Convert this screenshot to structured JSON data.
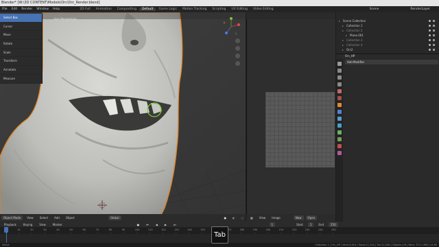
{
  "window": {
    "title": "Blender* [W:\\3D CONTENT\\Models\\Orc\\Orc_Render.blend]"
  },
  "menu": {
    "items": [
      "File",
      "Edit",
      "Render",
      "Window",
      "Help"
    ],
    "workspaces": [
      "2D Full",
      "Animation",
      "Compositing",
      "Default",
      "Game Logic",
      "Motion Tracking",
      "Scripting",
      "UV Editing",
      "Video Editing"
    ],
    "active_workspace": "Default",
    "scene_label": "Scene",
    "viewlayer_label": "RenderLayer"
  },
  "viewport": {
    "overlay_text": "User Perspective",
    "tools": [
      "Select Box",
      "Cursor",
      "Move",
      "Rotate",
      "Scale",
      "Transform",
      "Annotate",
      "Measure"
    ],
    "footer": {
      "mode": "Object Mode",
      "view": "View",
      "select": "Select",
      "add": "Add",
      "object": "Object",
      "orientation": "Global"
    }
  },
  "image_editor": {
    "view": "View",
    "image": "Image",
    "new": "New",
    "open": "Open"
  },
  "outliner": {
    "rows": [
      {
        "label": "Scene Collection",
        "dim": false,
        "indent": 0
      },
      {
        "label": "Collection 1",
        "dim": false,
        "indent": 1
      },
      {
        "label": "Collection 2",
        "dim": true,
        "indent": 1
      },
      {
        "label": "Plane.001",
        "dim": false,
        "indent": 2
      },
      {
        "label": "Collection 3",
        "dim": true,
        "indent": 1
      },
      {
        "label": "Collection 4",
        "dim": true,
        "indent": 1
      },
      {
        "label": "Orc2",
        "dim": false,
        "indent": 1
      }
    ]
  },
  "properties": {
    "object_name": "Orc_HP",
    "add_modifier": "Add Modifier"
  },
  "timeline": {
    "menus": [
      "Playback",
      "Keying",
      "View",
      "Marker"
    ],
    "current_frame": "1",
    "start_label": "Start",
    "start": "1",
    "end_label": "End",
    "end": "250",
    "ticks": [
      "0",
      "10",
      "20",
      "30",
      "40",
      "50",
      "60",
      "70",
      "80",
      "90",
      "100",
      "110",
      "120",
      "130",
      "140",
      "150",
      "160",
      "170",
      "180",
      "190",
      "200",
      "210",
      "220",
      "230",
      "240",
      "250"
    ]
  },
  "status": {
    "left": "Select",
    "right": "Collection 1 | Orc_HP | Verts:5,624 | Faces:11,104 | Tris:22,208 | Objects:1/8 | Mem: 373.1 MiB | v2.80"
  },
  "keycast": {
    "key": "Tab"
  },
  "colors": {
    "select_blue": "#4772b3",
    "skin": "#c9c9c6",
    "outline_orange": "#e0831f"
  }
}
